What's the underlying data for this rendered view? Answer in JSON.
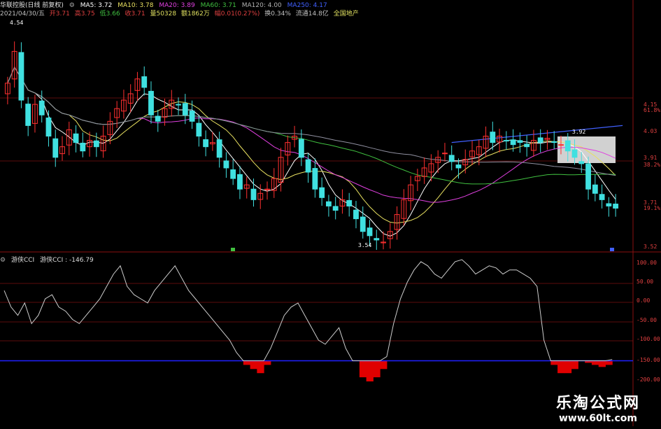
{
  "header": {
    "stock_name": "华联控股(日线 前复权)",
    "ma5": "MA5: 3.72",
    "ma10": "MA10: 3.78",
    "ma20": "MA20: 3.89",
    "ma60": "MA60: 3.71",
    "ma120": "MA120: 4.00",
    "ma250": "MA250: 4.17"
  },
  "subheader": {
    "date": "2021/04/30/五",
    "open": "开3.71",
    "high": "高3.75",
    "low": "低3.66",
    "close": "收3.71",
    "volume": "量50328",
    "amount": "额1862万",
    "change": "幅0.01(0.27%)",
    "turnover": "换0.34%",
    "float_cap": "流通14.8亿",
    "sector": "全国地产"
  },
  "price_annotations": {
    "high_mark": "4.54",
    "low_mark": "3.54",
    "box_top": "3.92",
    "box_low": "3.92"
  },
  "price_axis": {
    "labels": [
      "4.15",
      "61.8%",
      "4.03",
      "3.91",
      "38.2%",
      "3.71",
      "19.1%",
      "3.52"
    ],
    "colors": [
      "#e04040",
      "#e04040",
      "#e04040",
      "#e04040",
      "#e04040",
      "#e04040",
      "#e04040",
      "#e04040"
    ]
  },
  "indicator": {
    "name": "游侠CCI",
    "value_label": "游侠CCI : -146.79",
    "axis_labels": [
      "100.00",
      "50.00",
      "0.00",
      "-50.00",
      "-100.00",
      "-150.00",
      "-200.00"
    ]
  },
  "watermark": {
    "cn": "乐淘公式网",
    "url": "www.60lt.com"
  },
  "colors": {
    "bg": "#000000",
    "up_candle": "#ff3030",
    "down_candle": "#40e0e0",
    "ma5": "#ffffff",
    "ma10": "#e8e060",
    "ma20": "#e040e0",
    "ma60": "#40c040",
    "ma120": "#9090a0",
    "ma250": "#4060ff",
    "cci_line": "#cccccc",
    "cci_bar": "#e00000",
    "cci_base": "#2020ff",
    "grid": "#7a1010"
  },
  "chart_data": [
    {
      "type": "candlestick",
      "title": "华联控股(日线 前复权)",
      "ylim": [
        3.52,
        4.6
      ],
      "highest": 4.54,
      "lowest": 3.54,
      "series": [
        {
          "name": "MA5",
          "last": 3.72
        },
        {
          "name": "MA10",
          "last": 3.78
        },
        {
          "name": "MA20",
          "last": 3.89
        },
        {
          "name": "MA60",
          "last": 3.71
        },
        {
          "name": "MA120",
          "last": 4.0
        },
        {
          "name": "MA250",
          "last": 4.17
        }
      ],
      "closes": [
        4.3,
        4.45,
        4.22,
        4.1,
        4.2,
        4.15,
        4.05,
        3.95,
        4.0,
        4.08,
        4.02,
        3.98,
        4.03,
        4.0,
        4.05,
        4.12,
        4.18,
        4.22,
        4.25,
        4.32,
        4.28,
        4.15,
        4.12,
        4.18,
        4.22,
        4.2,
        4.15,
        4.12,
        4.05,
        4.0,
        4.02,
        3.95,
        3.9,
        3.85,
        3.8,
        3.82,
        3.75,
        3.78,
        3.8,
        3.85,
        3.95,
        4.02,
        4.05,
        3.95,
        3.88,
        3.8,
        3.76,
        3.72,
        3.7,
        3.75,
        3.72,
        3.66,
        3.6,
        3.58,
        3.56,
        3.55,
        3.6,
        3.68,
        3.75,
        3.82,
        3.86,
        3.9,
        3.92,
        3.95,
        3.97,
        3.93,
        3.9,
        3.94,
        3.98,
        4.0,
        4.05,
        4.02,
        4.05,
        4.03,
        4.01,
        4.02,
        4.0,
        4.03,
        4.02,
        4.04,
        4.02,
        4.01,
        3.98,
        3.95,
        3.92,
        3.8,
        3.78,
        3.75,
        3.72,
        3.71
      ]
    },
    {
      "type": "line",
      "title": "游侠CCI",
      "ylim": [
        -200,
        100
      ],
      "series": [
        {
          "name": "游侠CCI",
          "last": -146.79
        }
      ],
      "baseline": -150,
      "values": [
        20,
        -20,
        -40,
        -10,
        -60,
        -40,
        0,
        10,
        -20,
        -30,
        -50,
        -60,
        -40,
        -20,
        0,
        30,
        60,
        80,
        30,
        10,
        0,
        -10,
        20,
        40,
        60,
        80,
        50,
        20,
        0,
        -20,
        -40,
        -60,
        -80,
        -100,
        -130,
        -160,
        -170,
        -180,
        -160,
        -120,
        -80,
        -40,
        -20,
        -10,
        -40,
        -70,
        -100,
        -110,
        -90,
        -70,
        -120,
        -150,
        -190,
        -200,
        -190,
        -170,
        -140,
        -60,
        0,
        40,
        70,
        90,
        80,
        60,
        50,
        70,
        90,
        95,
        80,
        60,
        70,
        80,
        75,
        60,
        70,
        70,
        60,
        50,
        30,
        -100,
        -160,
        -180,
        -180,
        -170,
        -150,
        -155,
        -160,
        -165,
        -160,
        -147
      ]
    }
  ]
}
